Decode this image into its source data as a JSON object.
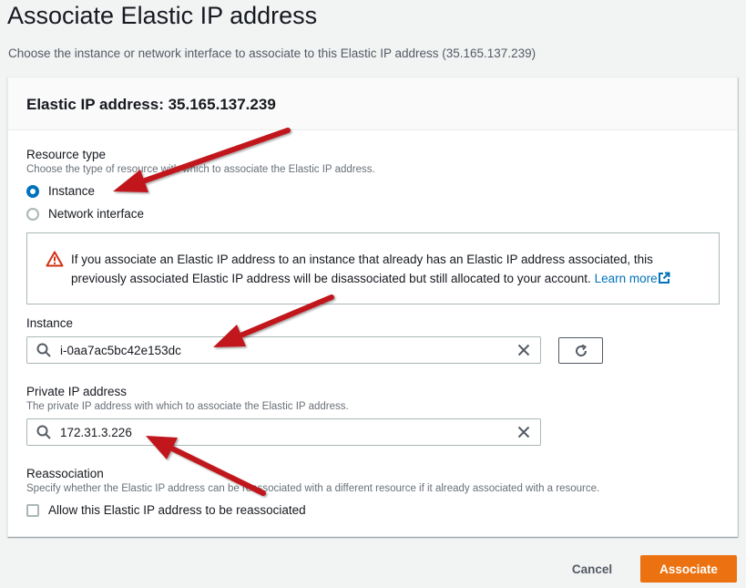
{
  "page": {
    "title": "Associate Elastic IP address",
    "description": "Choose the instance or network interface to associate to this Elastic IP address (35.165.137.239)"
  },
  "card": {
    "title": "Elastic IP address: 35.165.137.239"
  },
  "resource_type": {
    "label": "Resource type",
    "description": "Choose the type of resource with which to associate the Elastic IP address.",
    "options": [
      {
        "label": "Instance",
        "selected": true
      },
      {
        "label": "Network interface",
        "selected": false
      }
    ]
  },
  "alert": {
    "icon": "warning-icon",
    "text": "If you associate an Elastic IP address to an instance that already has an Elastic IP address associated, this previously associated Elastic IP address will be disassociated but still allocated to your account.",
    "link_text": "Learn more"
  },
  "instance": {
    "label": "Instance",
    "value": "i-0aa7ac5bc42e153dc"
  },
  "private_ip": {
    "label": "Private IP address",
    "description": "The private IP address with which to associate the Elastic IP address.",
    "value": "172.31.3.226"
  },
  "reassociation": {
    "label": "Reassociation",
    "description": "Specify whether the Elastic IP address can be reassociated with a different resource if it already associated with a resource.",
    "checkbox_label": "Allow this Elastic IP address to be reassociated",
    "checked": false
  },
  "footer": {
    "cancel_label": "Cancel",
    "associate_label": "Associate"
  },
  "colors": {
    "primary": "#ec7211",
    "link": "#0073bb",
    "warning": "#d13212",
    "annotation_arrow": "#c0161b"
  }
}
